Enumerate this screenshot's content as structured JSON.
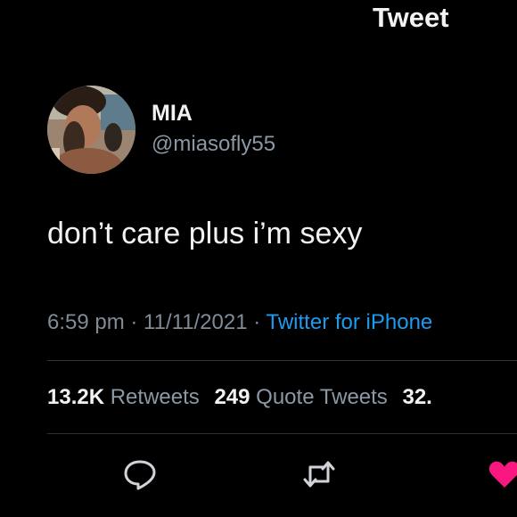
{
  "header": {
    "title": "Tweet"
  },
  "author": {
    "display_name": "MIA",
    "handle": "@miasofly55"
  },
  "tweet": {
    "text": "don’t care plus i’m sexy",
    "time": "6:59 pm",
    "date": "11/11/2021",
    "separator": " · ",
    "source": "Twitter for iPhone"
  },
  "stats": {
    "retweets_count": "13.2K",
    "retweets_label": "Retweets",
    "quotes_count": "249",
    "quotes_label": "Quote Tweets",
    "likes_count": "32."
  },
  "actions": [
    {
      "icon": "reply-icon"
    },
    {
      "icon": "retweet-icon"
    },
    {
      "icon": "like-icon",
      "color": "#f91880"
    }
  ],
  "colors": {
    "background": "#000000",
    "primary_text": "#f2f2f2",
    "secondary_text": "#8b98a5",
    "link": "#1d9bf0",
    "like": "#f91880",
    "divider": "#2f3336"
  }
}
